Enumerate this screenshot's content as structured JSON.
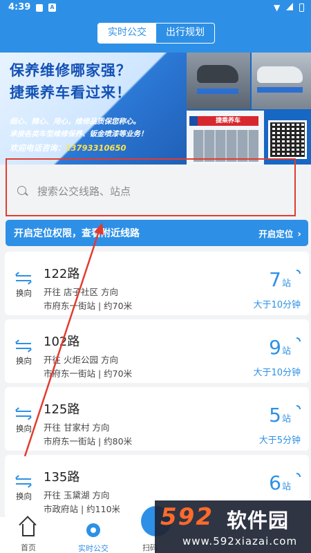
{
  "status_bar": {
    "time": "4:39",
    "notif_a": "A"
  },
  "header": {
    "tabs": [
      {
        "label": "实时公交",
        "active": true
      },
      {
        "label": "出行规划",
        "active": false
      }
    ]
  },
  "banner": {
    "headline_1": "保养维修哪家强？",
    "headline_2": "捷乘养车看过来！",
    "line_1": "细心、精心、用心，维修品质保您称心。",
    "line_2": "承接各类车型维修保养、钣金喷漆等业务！",
    "line_3_prefix": "欢迎电话咨询：",
    "phone": "13793310650",
    "shop_sign": "捷乘养车"
  },
  "search": {
    "placeholder": "搜索公交线路、站点"
  },
  "location_bar": {
    "message": "开启定位权限，查看附近线路",
    "action": "开启定位",
    "chevron": "›"
  },
  "routes": [
    {
      "swap_label": "换向",
      "name": "122路",
      "direction": "开往 店子社区 方向",
      "stop": "市府东一街站 | 约70米",
      "stops_away": "7",
      "stops_unit": "站",
      "eta": "大于10分钟"
    },
    {
      "swap_label": "换向",
      "name": "102路",
      "direction": "开往 火炬公园 方向",
      "stop": "市府东一街站 | 约70米",
      "stops_away": "9",
      "stops_unit": "站",
      "eta": "大于10分钟"
    },
    {
      "swap_label": "换向",
      "name": "125路",
      "direction": "开往 甘家村 方向",
      "stop": "市府东一街站 | 约80米",
      "stops_away": "5",
      "stops_unit": "站",
      "eta": "大于5分钟"
    },
    {
      "swap_label": "换向",
      "name": "135路",
      "direction": "开往 玉黛湖 方向",
      "stop": "市政府站 | 约110米",
      "stops_away": "6",
      "stops_unit": "站",
      "eta": ""
    }
  ],
  "bottom_nav": {
    "items": [
      {
        "label": "首页",
        "icon": "home-icon"
      },
      {
        "label": "实时公交",
        "icon": "bus-icon",
        "active": true
      },
      {
        "label": "扫码",
        "icon": "scan-icon"
      }
    ]
  },
  "watermark": {
    "logo": "592",
    "title": "软件园",
    "url": "www.592xiazai.com"
  },
  "colors": {
    "primary": "#2d90e6",
    "annotation_red": "#e23b2e",
    "background": "#f2f3f5"
  }
}
